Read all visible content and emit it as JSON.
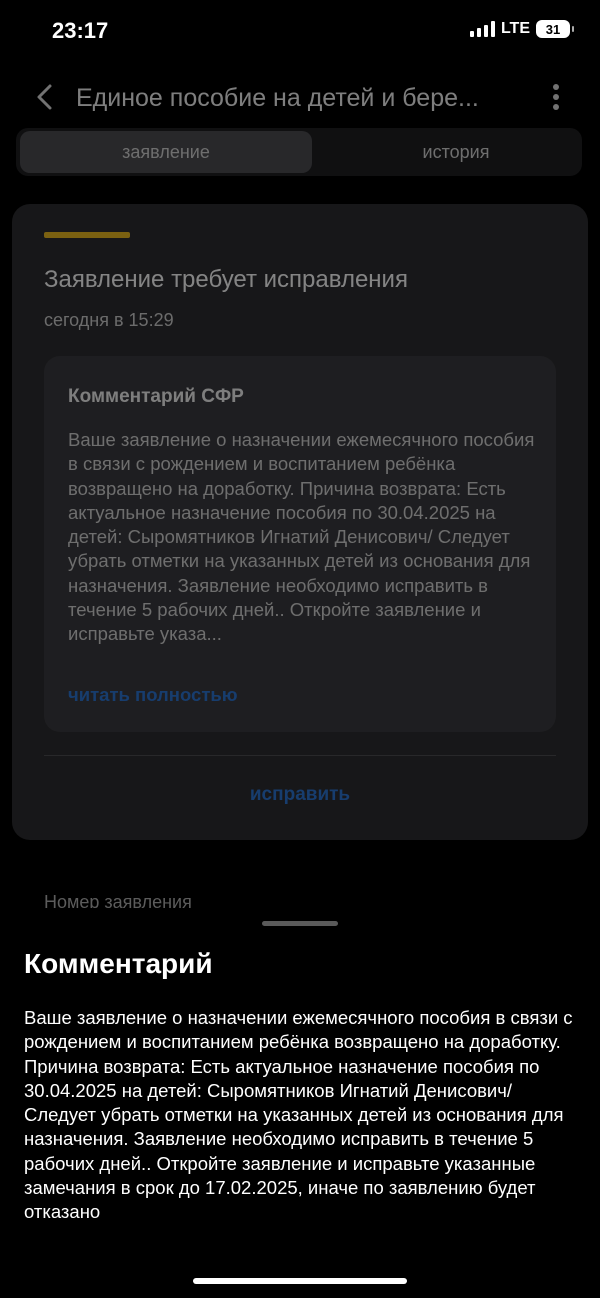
{
  "status_bar": {
    "time": "23:17",
    "network": "LTE",
    "battery": "31"
  },
  "header": {
    "title": "Единое пособие на детей и бере..."
  },
  "tabs": [
    {
      "label": "заявление"
    },
    {
      "label": "история"
    }
  ],
  "card": {
    "accent_color": "#e0b11f",
    "title": "Заявление требует исправления",
    "time": "сегодня в 15:29",
    "comment_title": "Комментарий СФР",
    "comment_text": "Ваше заявление о назначении ежемесячного пособия в связи с рождением и воспитанием ребёнка возвращено на доработку. Причина возврата: Есть актуальное назначение пособия по 30.04.2025 на детей: Сыромятников Игнатий Денисович/ Следует убрать отметки на указанных детей из основания для назначения. Заявление необходимо исправить в течение 5 рабочих дней.. Откройте заявление и исправьте указа...",
    "read_more": "читать полностью",
    "fix_button": "исправить"
  },
  "application_number_label": "Номер заявления",
  "sheet": {
    "title": "Комментарий",
    "text": "Ваше заявление о назначении ежемесячного пособия в связи с рождением и воспитанием ребёнка возвращено на доработку. Причина возврата: Есть актуальное назначение пособия по 30.04.2025 на детей: Сыромятников Игнатий Денисович/ Следует убрать отметки на указанных детей из основания для назначения. Заявление необходимо исправить в течение 5 рабочих дней.. Откройте заявление и исправьте указанные замечания в срок до 17.02.2025, иначе по заявлению будет отказано"
  },
  "colors": {
    "link": "#2a6fc9",
    "background": "#000000",
    "card": "#2b2b2e"
  },
  "icons": {
    "back": "chevron-left-icon",
    "more": "more-vertical-icon"
  }
}
